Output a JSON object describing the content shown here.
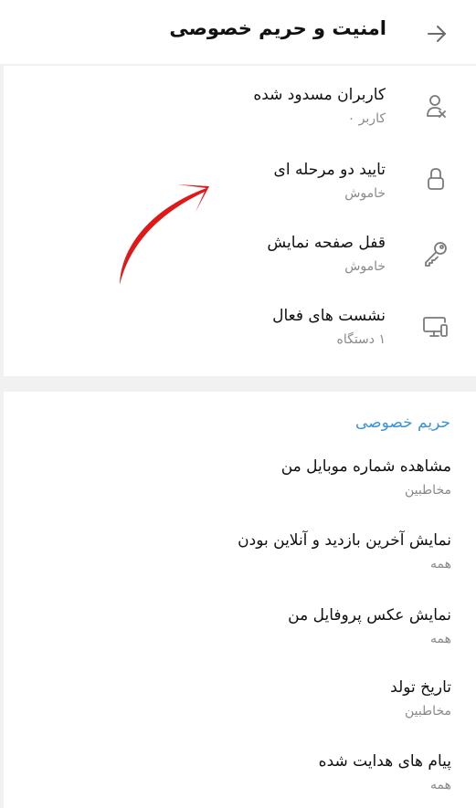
{
  "header": {
    "title": "امنیت و حریم خصوصی",
    "back_icon": "arrow-right-icon"
  },
  "security": {
    "items": [
      {
        "title": "کاربران مسدود شده",
        "subtitle": "کاربر ۰",
        "icon": "blocked-user-icon"
      },
      {
        "title": "تایید دو مرحله ای",
        "subtitle": "خاموش",
        "icon": "lock-icon"
      },
      {
        "title": "قفل صفحه نمایش",
        "subtitle": "خاموش",
        "icon": "key-icon"
      },
      {
        "title": "نشست های فعال",
        "subtitle": "۱ دستگاه",
        "icon": "devices-icon"
      }
    ]
  },
  "privacy": {
    "section_title": "حریم خصوصی",
    "items": [
      {
        "title": "مشاهده شماره موبایل من",
        "subtitle": "مخاطبین"
      },
      {
        "title": "نمایش آخرین بازدید و آنلاین بودن",
        "subtitle": "همه"
      },
      {
        "title": "نمایش عکس پروفایل من",
        "subtitle": "همه"
      },
      {
        "title": "تاریخ تولد",
        "subtitle": "مخاطبین"
      },
      {
        "title": "پیام های هدایت شده",
        "subtitle": "همه"
      }
    ]
  },
  "colors": {
    "accent": "#3a95d4",
    "annotation_arrow": "#e01818",
    "icon": "#7a7a7a",
    "subtitle": "#8a8a8a"
  }
}
